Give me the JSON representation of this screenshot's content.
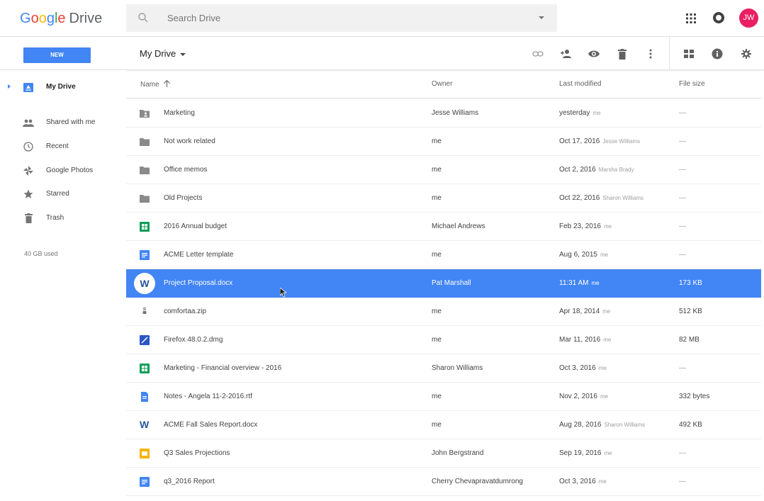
{
  "app": {
    "logo": {
      "g": "G",
      "o1": "o",
      "o2": "o",
      "g2": "g",
      "l": "l",
      "e": "e",
      "product": "Drive"
    },
    "avatar_initials": "JW",
    "brand_colors": {
      "blue": "#4285f4",
      "red": "#ea4335",
      "yellow": "#fbbc05",
      "green": "#34a853",
      "avatar": "#e91e63"
    }
  },
  "search": {
    "placeholder": "Search Drive",
    "icon": "search-icon",
    "dropdown_icon": "chevron-down-icon"
  },
  "header_icons": [
    "apps-grid-icon",
    "notifications-icon"
  ],
  "subbar": {
    "new_label": "NEW",
    "breadcrumb": "My Drive",
    "toolbar_icons": [
      "link-icon",
      "add-person-icon",
      "preview-eye-icon",
      "trash-icon",
      "more-vert-icon",
      "grid-view-icon",
      "info-icon",
      "settings-gear-icon"
    ]
  },
  "sidebar": {
    "items": [
      {
        "label": "My Drive",
        "icon": "my-drive-icon",
        "active": true
      },
      {
        "label": "Shared with me",
        "icon": "shared-people-icon"
      },
      {
        "label": "Recent",
        "icon": "clock-icon"
      },
      {
        "label": "Google Photos",
        "icon": "pinwheel-icon"
      },
      {
        "label": "Starred",
        "icon": "star-icon"
      },
      {
        "label": "Trash",
        "icon": "trash-icon"
      }
    ],
    "storage": "40 GB used"
  },
  "table": {
    "headers": {
      "name": "Name",
      "sort_icon": "arrow-up-icon",
      "owner": "Owner",
      "modified": "Last modified",
      "size": "File size"
    },
    "rows": [
      {
        "name": "Marketing",
        "owner": "Jesse Williams",
        "modified": "yesterday",
        "modified_by": "me",
        "size": "—",
        "icon": "shared-folder-icon"
      },
      {
        "name": "Not work related",
        "owner": "me",
        "modified": "Oct 17, 2016",
        "modified_by": "Jesse Williams",
        "size": "—",
        "icon": "folder-icon"
      },
      {
        "name": "Office memos",
        "owner": "me",
        "modified": "Oct 2, 2016",
        "modified_by": "Marsha Brady",
        "size": "—",
        "icon": "folder-icon"
      },
      {
        "name": "Old Projects",
        "owner": "me",
        "modified": "Oct 22, 2016",
        "modified_by": "Sharon Williams",
        "size": "—",
        "icon": "folder-icon"
      },
      {
        "name": "2016 Annual budget",
        "owner": "Michael Andrews",
        "modified": "Feb 23, 2016",
        "modified_by": "me",
        "size": "—",
        "icon": "sheets-icon"
      },
      {
        "name": "ACME Letter template",
        "owner": "me",
        "modified": "Aug 6, 2015",
        "modified_by": "me",
        "size": "—",
        "icon": "docs-icon"
      },
      {
        "name": "Project Proposal.docx",
        "owner": "Pat Marshall",
        "modified": "11:31 AM",
        "modified_by": "me",
        "size": "173 KB",
        "icon": "word-icon",
        "selected": true,
        "icon_letter": "W"
      },
      {
        "name": "comfortaa.zip",
        "owner": "me",
        "modified": "Apr 18, 2014",
        "modified_by": "me",
        "size": "512 KB",
        "icon": "zip-icon"
      },
      {
        "name": "Firefox 48.0.2.dmg",
        "owner": "me",
        "modified": "Mar 11, 2016",
        "modified_by": "me",
        "size": "82 MB",
        "icon": "disk-image-icon"
      },
      {
        "name": "Marketing - Financial overview - 2016",
        "owner": "Sharon Williams",
        "modified": "Oct 3, 2016",
        "modified_by": "me",
        "size": "—",
        "icon": "sheets-icon"
      },
      {
        "name": "Notes - Angela 11-2-2016.rtf",
        "owner": "me",
        "modified": "Nov 2, 2016",
        "modified_by": "me",
        "size": "332 bytes",
        "icon": "text-file-icon"
      },
      {
        "name": "ACME Fall Sales Report.docx",
        "owner": "me",
        "modified": "Aug 28, 2016",
        "modified_by": "Sharon Williams",
        "size": "492 KB",
        "icon": "word-icon",
        "icon_letter": "W"
      },
      {
        "name": "Q3 Sales Projections",
        "owner": "John Bergstrand",
        "modified": "Sep 19, 2016",
        "modified_by": "me",
        "size": "—",
        "icon": "slides-icon"
      },
      {
        "name": "q3_2016 Report",
        "owner": "Cherry Chevapravatdumrong",
        "modified": "Oct 3, 2016",
        "modified_by": "me",
        "size": "—",
        "icon": "docs-icon"
      }
    ]
  }
}
